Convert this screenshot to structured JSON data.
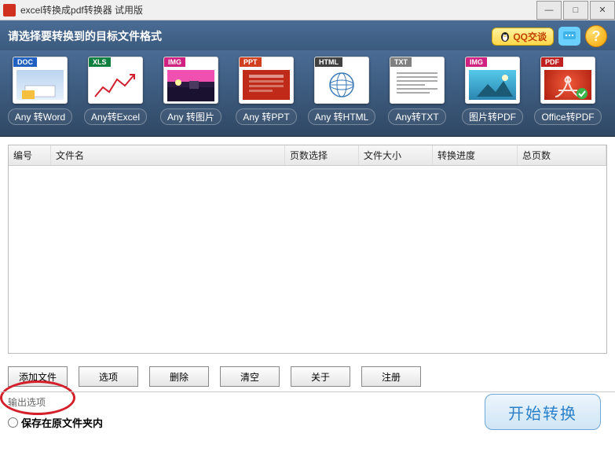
{
  "window": {
    "title": "excel转换成pdf转换器 试用版"
  },
  "header": {
    "prompt": "请选择要转换到的目标文件格式",
    "qq_label": "QQ交谈",
    "help_symbol": "?"
  },
  "formats": [
    {
      "tag": "DOC",
      "label": "Any 转Word"
    },
    {
      "tag": "XLS",
      "label": "Any转Excel"
    },
    {
      "tag": "IMG",
      "label": "Any 转图片"
    },
    {
      "tag": "PPT",
      "label": "Any 转PPT"
    },
    {
      "tag": "HTML",
      "label": "Any 转HTML"
    },
    {
      "tag": "TXT",
      "label": "Any转TXT"
    },
    {
      "tag": "IMG",
      "label": "图片转PDF"
    },
    {
      "tag": "PDF",
      "label": "Office转PDF"
    }
  ],
  "columns": {
    "id": "编号",
    "name": "文件名",
    "pages": "页数选择",
    "size": "文件大小",
    "progress": "转换进度",
    "total": "总页数"
  },
  "buttons": {
    "add": "添加文件",
    "options": "选项",
    "delete": "删除",
    "clear": "清空",
    "about": "关于",
    "register": "注册"
  },
  "output": {
    "section_title": "输出选项",
    "save_in_src": "保存在原文件夹内"
  },
  "start_label": "开始转换"
}
